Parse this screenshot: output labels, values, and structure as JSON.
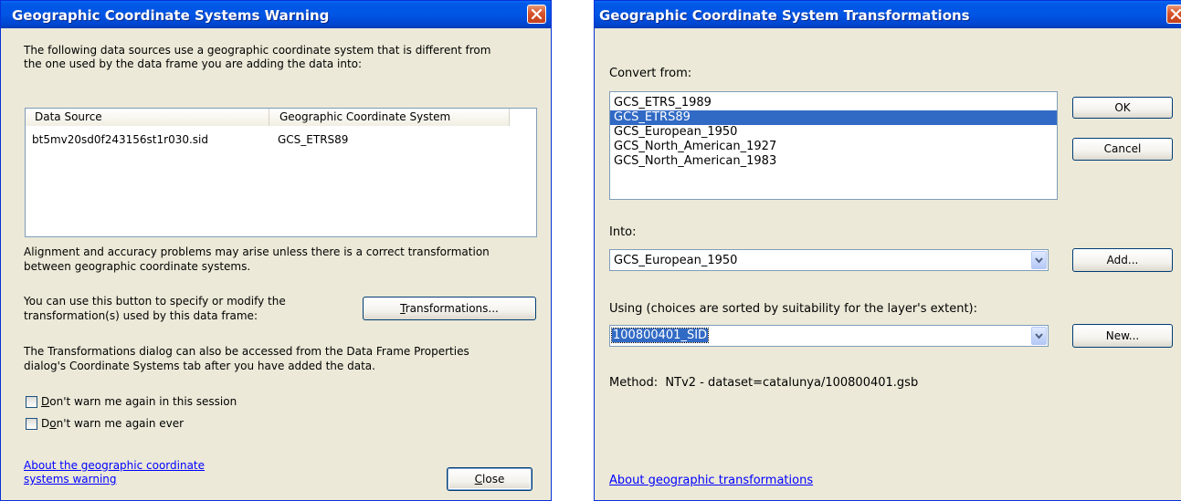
{
  "warning_dialog": {
    "title": "Geographic Coordinate Systems Warning",
    "intro_line1": "The following data sources use a geographic coordinate system that is different from",
    "intro_line2": "the one used by the data frame you are adding the data into:",
    "table": {
      "headers": [
        "Data Source",
        "Geographic Coordinate System"
      ],
      "rows": [
        {
          "source": "bt5mv20sd0f243156st1r030.sid",
          "gcs": "GCS_ETRS89"
        }
      ]
    },
    "alignment_line1": "Alignment and accuracy problems may arise unless there is a correct transformation",
    "alignment_line2": "between geographic coordinate systems.",
    "button_hint_line1": "You can use this button to specify or modify the",
    "button_hint_line2": "transformation(s) used by this data frame:",
    "transformations_button": {
      "mnemonic": "T",
      "rest": "ransformations..."
    },
    "access_line1": "The Transformations dialog can also be accessed from the Data Frame Properties",
    "access_line2": "dialog's Coordinate Systems tab after you have added the data.",
    "checkbox_session": {
      "mnemonic": "D",
      "rest": "on't warn me again in this session",
      "checked": false
    },
    "checkbox_ever": {
      "pre": "D",
      "mnemonic": "o",
      "rest": "n't warn me again ever",
      "checked": false
    },
    "about_link_line1": "About the geographic coordinate",
    "about_link_line2": "systems warning",
    "close_button": {
      "mnemonic": "C",
      "rest": "lose"
    }
  },
  "transform_dialog": {
    "title": "Geographic Coordinate System Transformations",
    "convert_from_label": "Convert from:",
    "convert_from_items": [
      {
        "label": "GCS_ETRS_1989",
        "selected": false
      },
      {
        "label": "GCS_ETRS89",
        "selected": true
      },
      {
        "label": "GCS_European_1950",
        "selected": false
      },
      {
        "label": "GCS_North_American_1927",
        "selected": false
      },
      {
        "label": "GCS_North_American_1983",
        "selected": false
      }
    ],
    "into_label": "Into:",
    "into_value": "GCS_European_1950",
    "using_label": "Using (choices are sorted by suitability for the layer's extent):",
    "using_value": "100800401_SID",
    "method_label": "Method:",
    "method_value": "NTv2 - dataset=catalunya/100800401.gsb",
    "ok_label": "OK",
    "cancel_label": "Cancel",
    "add_label": "Add...",
    "new_label": "New...",
    "about_link": "About geographic transformations"
  },
  "colors": {
    "title_bar": "#0055e5",
    "dialog_bg": "#ece9d8",
    "selection": "#316ac5",
    "link": "#0000ff",
    "close_x": "#d7532b"
  },
  "icons": {
    "close": "close-x-icon",
    "dropdown": "chevron-down-icon",
    "checkbox": "checkbox-icon"
  }
}
